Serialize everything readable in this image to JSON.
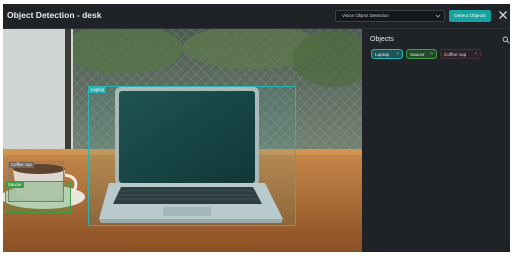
{
  "header": {
    "title": "Object Detection - desk",
    "model_select_value": "Vision Object Detection",
    "detect_button": "Detect Objects",
    "close_icon": "close-icon"
  },
  "colors": {
    "laptop": "#28b3b5",
    "saucer": "#3f9d48",
    "coffee_cup": "#c4557a",
    "accent": "#16a3a0",
    "panel_bg": "#1f2327"
  },
  "detections": [
    {
      "label": "Laptop",
      "color": "#28b3b5"
    },
    {
      "label": "Coffee cup",
      "color": "#8a7f73"
    },
    {
      "label": "Saucer",
      "color": "#3f9d48"
    }
  ],
  "panel": {
    "title": "Objects",
    "search_icon": "search-icon",
    "chips": [
      {
        "label": "Laptop",
        "remove": "×"
      },
      {
        "label": "Saucer",
        "remove": "×"
      },
      {
        "label": "Coffee cup",
        "remove": "×"
      }
    ]
  }
}
